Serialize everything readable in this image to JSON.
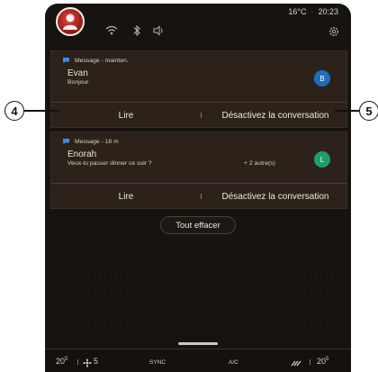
{
  "status_bar": {
    "temperature": "16°C",
    "time": "20:23"
  },
  "notifications": [
    {
      "meta": "Message - mainten.",
      "sender": "Evan",
      "preview": "Bonjour",
      "extra": "",
      "badge": "B",
      "badge_color": "#1c6fb8",
      "actions": {
        "read": "Lire",
        "mute": "Désactivez la conversation"
      }
    },
    {
      "meta": "Message - 18 m",
      "sender": "Enorah",
      "preview": "Veux-tu passer dinner ce soir ?",
      "extra": "+ 2 autre(s)",
      "badge": "L",
      "badge_color": "#1e9e6a",
      "actions": {
        "read": "Lire",
        "mute": "Désactivez la conversation"
      }
    }
  ],
  "clear_all_label": "Tout effacer",
  "climate_bar": {
    "left_temp": "20",
    "left_temp_unit": "5",
    "fan_level": "5",
    "sync_label": "SYNC",
    "ac_label": "A/C",
    "right_temp": "20",
    "right_temp_unit": "5"
  },
  "callouts": {
    "left": "4",
    "right": "5"
  },
  "colors": {
    "screen_bg": "#161310",
    "card_bg": "#2c221a",
    "message_icon": "#3a8fe0"
  }
}
